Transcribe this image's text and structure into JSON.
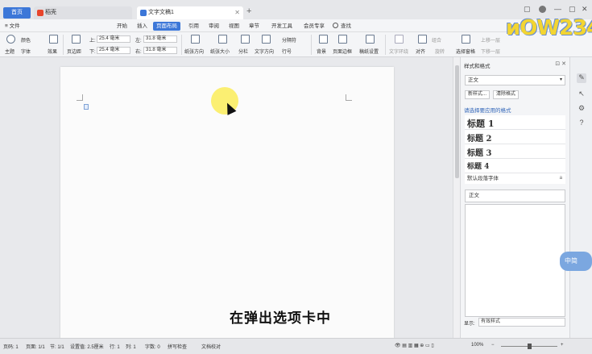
{
  "tabs": {
    "home": "首页",
    "t1": "稻壳",
    "t2": "文字文稿1"
  },
  "menu": {
    "file": "≡ 文件",
    "items": [
      "开始",
      "插入",
      "页面布局",
      "引用",
      "审阅",
      "视图",
      "章节",
      "开发工具",
      "会员专享"
    ],
    "active": "页面布局",
    "search": "查找"
  },
  "ribbon": {
    "theme": "主题",
    "colors": "颜色",
    "fonts": "字体",
    "effects": "效果",
    "margins": "页边距",
    "top_label": "上:",
    "top_val": "25.4 毫米",
    "bottom_label": "下:",
    "bottom_val": "25.4 毫米",
    "left_label": "左:",
    "left_val": "31.8 毫米",
    "right_label": "右:",
    "right_val": "31.8 毫米",
    "orientation": "纸张方向",
    "size": "纸张大小",
    "columns": "分栏",
    "text_dir": "文字方向",
    "line_num": "行号",
    "breaks": "分隔符",
    "background": "背景",
    "border": "页面边框",
    "paper_setup": "稿纸设置",
    "wrap": "文字环绕",
    "align": "对齐",
    "rotate": "旋转",
    "select_pane": "选择窗格",
    "bring_up": "上移一层",
    "send_down": "下移一层",
    "group": "组合"
  },
  "panel": {
    "title": "样式和格式",
    "current": "正文",
    "new_style": "新样式...",
    "clear_format": "清除格式",
    "apply_label": "请选择要应用的格式",
    "headings": [
      "标题 1",
      "标题 2",
      "标题 3",
      "标题 4"
    ],
    "default_font": "默认段落字体",
    "body": "正文",
    "show_label": "显示:",
    "show_value": "有效样式"
  },
  "subtitle": "在弹出选项卡中",
  "bubble": "中简",
  "status": {
    "page": "页码: 1",
    "pages": "页面: 1/1",
    "section": "节: 1/1",
    "setting": "设置值: 2.5厘米",
    "row": "行: 1",
    "col": "列: 1",
    "words": "字数: 0",
    "spell": "拼写检查",
    "proof": "文档校对",
    "zoom": "100%"
  }
}
